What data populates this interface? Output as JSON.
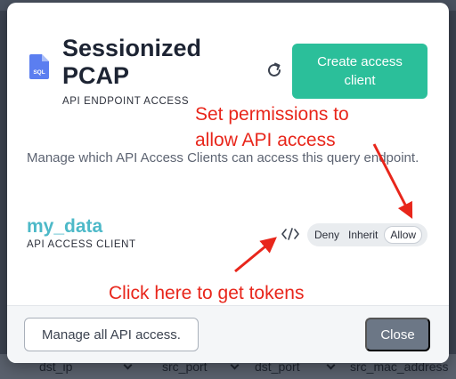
{
  "background": {
    "columns": [
      "dst_ip",
      "src_port",
      "dst_port",
      "src_mac_address"
    ]
  },
  "modal": {
    "icon_label": "SQL",
    "title": "Sessionized PCAP",
    "subtitle": "API ENDPOINT ACCESS",
    "create_button": "Create access client",
    "description": "Manage which API Access Clients can access this query endpoint.",
    "client": {
      "name": "my_data",
      "type_label": "API ACCESS CLIENT",
      "options": [
        "Deny",
        "Inherit",
        "Allow"
      ],
      "selected": "Allow"
    },
    "footer": {
      "manage_button": "Manage all API access.",
      "close_button": "Close"
    }
  },
  "annotations": {
    "permissions_line1": "Set permissions to",
    "permissions_line2": "allow API access",
    "tokens": "Click here to get tokens"
  },
  "colors": {
    "accent": "#2bbf9a",
    "client_name": "#4db9c8",
    "annotation": "#e8261b",
    "close_button": "#6c7786"
  }
}
